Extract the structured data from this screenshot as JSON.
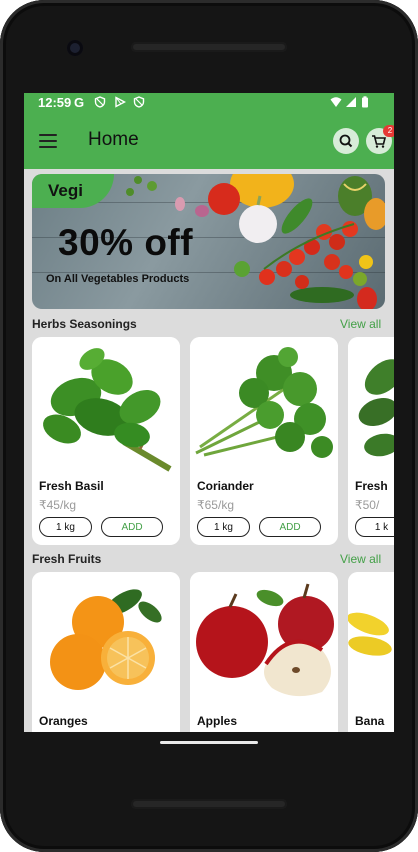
{
  "status": {
    "time": "12:59",
    "g_label": "G"
  },
  "appbar": {
    "title": "Home",
    "cart_count": "2"
  },
  "banner": {
    "tag": "Vegi",
    "discount": "30% off",
    "subtitle": "On All Vegetables Products"
  },
  "sections": [
    {
      "title": "Herbs Seasonings",
      "view_all": "View all",
      "items": [
        {
          "name": "Fresh Basil",
          "price": "₹45/kg",
          "qty": "1 kg",
          "add": "ADD",
          "image": "basil-image"
        },
        {
          "name": "Coriander",
          "price": "₹65/kg",
          "qty": "1 kg",
          "add": "ADD",
          "image": "coriander-image"
        },
        {
          "name": "Fresh",
          "price": "₹50/",
          "qty": "1 k",
          "add": "",
          "image": "mint-image"
        }
      ]
    },
    {
      "title": "Fresh Fruits",
      "view_all": "View all",
      "items": [
        {
          "name": "Oranges",
          "image": "oranges-image"
        },
        {
          "name": "Apples",
          "image": "apples-image"
        },
        {
          "name": "Bana",
          "image": "bananas-image"
        }
      ]
    }
  ],
  "colors": {
    "primary": "#4caf50",
    "accent_text": "#43a047",
    "badge": "#e53935"
  }
}
